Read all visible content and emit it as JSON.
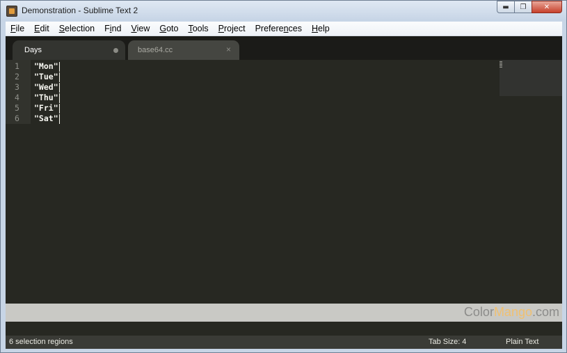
{
  "window": {
    "title": "Demonstration - Sublime Text 2",
    "controls": {
      "minimize": "▬",
      "maximize": "❐",
      "close": "✕"
    }
  },
  "menu": [
    {
      "accel": "F",
      "rest": "ile"
    },
    {
      "accel": "E",
      "rest": "dit"
    },
    {
      "accel": "S",
      "rest": "election"
    },
    {
      "pre": "F",
      "accel": "i",
      "rest": "nd"
    },
    {
      "accel": "V",
      "rest": "iew"
    },
    {
      "accel": "G",
      "rest": "oto"
    },
    {
      "accel": "T",
      "rest": "ools"
    },
    {
      "accel": "P",
      "rest": "roject"
    },
    {
      "pre": "Prefere",
      "accel": "n",
      "rest": "ces"
    },
    {
      "accel": "H",
      "rest": "elp"
    }
  ],
  "tabs": [
    {
      "label": "Days",
      "state": "active",
      "modified": true
    },
    {
      "label": "base64.cc",
      "state": "inactive",
      "close": "×"
    }
  ],
  "code_lines": [
    {
      "num": "1",
      "text": "\"Mon\""
    },
    {
      "num": "2",
      "text": "\"Tue\""
    },
    {
      "num": "3",
      "text": "\"Wed\""
    },
    {
      "num": "4",
      "text": "\"Thu\""
    },
    {
      "num": "5",
      "text": "\"Fri\""
    },
    {
      "num": "6",
      "text": "\"Sat\""
    }
  ],
  "watermark": {
    "part1": "Color",
    "part2": "Mango",
    "part3": ".com"
  },
  "status": {
    "selection": "6 selection regions",
    "tab_size": "Tab Size: 4",
    "syntax": "Plain Text"
  },
  "colors": {
    "editor_bg": "#272822",
    "gutter_bg": "#32332d",
    "text": "#f8f8f2",
    "status_bg": "#3a3b36"
  }
}
